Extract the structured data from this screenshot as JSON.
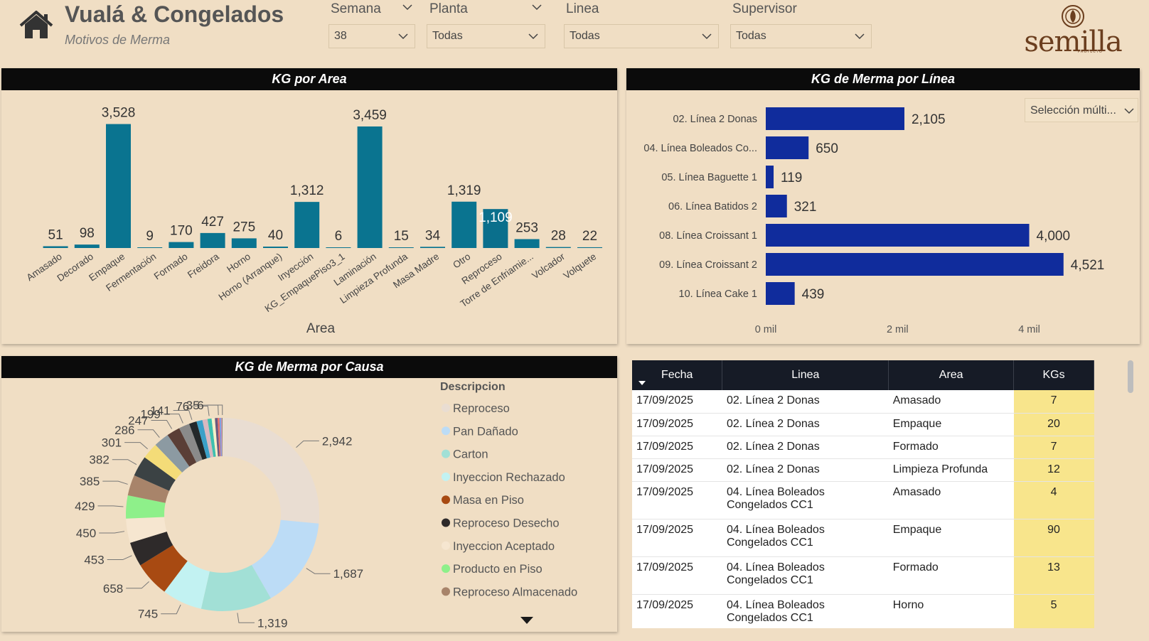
{
  "header": {
    "title": "Vualá & Congelados",
    "subtitle": "Motivos de Merma",
    "logo_text": "semilla",
    "logo_sub": "PROYECTO"
  },
  "filters": [
    {
      "label": "Semana",
      "value": "38"
    },
    {
      "label": "Planta",
      "value": "Todas"
    },
    {
      "label": "Linea",
      "value": "Todas"
    },
    {
      "label": "Supervisor",
      "value": "Todas"
    }
  ],
  "area_chart": {
    "title": "KG por Area",
    "xlabel": "Area",
    "bar_color": "#0a7490",
    "highlight_color": "#0a6f8c",
    "chart_data": {
      "type": "bar",
      "categories": [
        "Amasado",
        "Decorado",
        "Empaque",
        "Fermentación",
        "Formado",
        "Freidora",
        "Horno",
        "Horno (Arranque)",
        "Inyección",
        "KG_EmpaquePiso3_1",
        "Laminación",
        "Limpieza Profunda",
        "Masa Madre",
        "Otro",
        "Reproceso",
        "Torre de Enfriamie...",
        "Volcador",
        "Volquete"
      ],
      "values": [
        51,
        98,
        3528,
        9,
        170,
        427,
        275,
        40,
        1312,
        6,
        3459,
        15,
        34,
        1319,
        1109,
        253,
        28,
        22
      ],
      "labels": [
        "51",
        "98",
        "3,528",
        "9",
        "170",
        "427",
        "275",
        "40",
        "1,312",
        "6",
        "3,459",
        "15",
        "34",
        "1,319",
        "1,109",
        "253",
        "28",
        "22"
      ],
      "xlabel": "Area",
      "ylim": [
        0,
        3600
      ]
    }
  },
  "line_chart": {
    "title": "KG de Merma por Línea",
    "multi_select_label": "Selección múlti...",
    "bar_color": "#102c9c",
    "chart_data": {
      "type": "bar",
      "orientation": "horizontal",
      "categories": [
        "02. Línea 2 Donas",
        "04. Línea Boleados Co...",
        "05. Línea Baguette 1",
        "06. Línea Batidos 2",
        "08. Línea Croissant 1",
        "09. Línea Croissant 2",
        "10. Línea Cake 1"
      ],
      "values": [
        2105,
        650,
        119,
        321,
        4000,
        4521,
        439
      ],
      "labels": [
        "2,105",
        "650",
        "119",
        "321",
        "4,000",
        "4,521",
        "439"
      ],
      "xticks": [
        0,
        2000,
        4000
      ],
      "xtick_labels": [
        "0 mil",
        "2 mil",
        "4 mil"
      ],
      "xlim": [
        0,
        4750
      ]
    }
  },
  "cause_chart": {
    "title": "KG de Merma por Causa",
    "legend_title": "Descripcion",
    "chart_data": {
      "type": "pie",
      "donut": true,
      "slices": [
        {
          "name": "Reproceso",
          "value": 2942,
          "label": "2,942",
          "color": "#e9ddd2"
        },
        {
          "name": "Pan Dañado",
          "value": 1687,
          "label": "1,687",
          "color": "#bcdcf6"
        },
        {
          "name": "Carton",
          "value": 1319,
          "label": "1,319",
          "color": "#a2e0d6"
        },
        {
          "name": "Inyeccion Rechazado",
          "value": 745,
          "label": "745",
          "color": "#c2f2f2"
        },
        {
          "name": "Masa en Piso",
          "value": 658,
          "label": "658",
          "color": "#a84a12"
        },
        {
          "name": "Reproceso Desecho",
          "value": 453,
          "label": "453",
          "color": "#2e2a2a"
        },
        {
          "name": "Inyeccion Aceptado",
          "value": 450,
          "label": "450",
          "color": "#f6e6d0"
        },
        {
          "name": "Producto en Piso",
          "value": 429,
          "label": "429",
          "color": "#8ef08a"
        },
        {
          "name": "Reproceso Almacenado",
          "value": 385,
          "label": "385",
          "color": "#a8846a"
        },
        {
          "name": "",
          "value": 382,
          "label": "382",
          "color": "#3b4244"
        },
        {
          "name": "",
          "value": 301,
          "label": "301",
          "color": "#f4dc78"
        },
        {
          "name": "",
          "value": 286,
          "label": "286",
          "color": "#8c9aa2"
        },
        {
          "name": "",
          "value": 247,
          "label": "247",
          "color": "#5a3e36"
        },
        {
          "name": "",
          "value": 199,
          "label": "199",
          "color": "#8a8a8a"
        },
        {
          "name": "",
          "value": 141,
          "label": "141",
          "color": "#23282a"
        },
        {
          "name": "",
          "value": 110,
          "label": "",
          "color": "#3aa0c8"
        },
        {
          "name": "",
          "value": 95,
          "label": "",
          "color": "#d8b8c0"
        },
        {
          "name": "",
          "value": 76,
          "label": "76",
          "color": "#3ec0b0"
        },
        {
          "name": "",
          "value": 60,
          "label": "",
          "color": "#f6f0c8"
        },
        {
          "name": "",
          "value": 50,
          "label": "",
          "color": "#6a5a80"
        },
        {
          "name": "",
          "value": 35,
          "label": "35",
          "color": "#e8706a"
        },
        {
          "name": "",
          "value": 25,
          "label": "",
          "color": "#6aa0e8"
        },
        {
          "name": "",
          "value": 15,
          "label": "",
          "color": "#c88ad0"
        },
        {
          "name": "",
          "value": 10,
          "label": "",
          "color": "#c8a040"
        },
        {
          "name": "",
          "value": 6,
          "label": "6",
          "color": "#4a6ab0"
        }
      ]
    }
  },
  "table": {
    "columns": [
      "Fecha",
      "Linea",
      "Area",
      "KGs"
    ],
    "rows": [
      [
        "17/09/2025",
        "02. Línea 2 Donas",
        "Amasado",
        "7"
      ],
      [
        "17/09/2025",
        "02. Línea 2 Donas",
        "Empaque",
        "20"
      ],
      [
        "17/09/2025",
        "02. Línea 2 Donas",
        "Formado",
        "7"
      ],
      [
        "17/09/2025",
        "02. Línea 2 Donas",
        "Limpieza Profunda",
        "12"
      ],
      [
        "17/09/2025",
        "04. Línea Boleados Congelados CC1",
        "Amasado",
        "4"
      ],
      [
        "17/09/2025",
        "04. Línea Boleados Congelados CC1",
        "Empaque",
        "90"
      ],
      [
        "17/09/2025",
        "04. Línea Boleados Congelados CC1",
        "Formado",
        "13"
      ],
      [
        "17/09/2025",
        "04. Línea Boleados Congelados CC1",
        "Horno",
        "5"
      ]
    ]
  }
}
